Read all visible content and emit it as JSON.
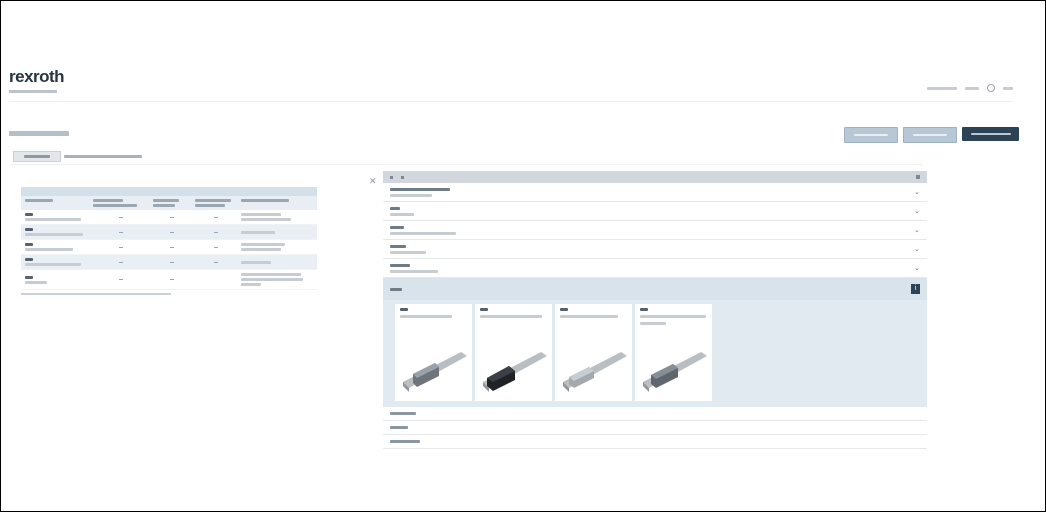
{
  "header": {
    "brand_name": "rexroth",
    "brand_color": "#2a3440"
  },
  "actions": {
    "primary_color": "#2c4356",
    "secondary_color": "#b8c7d6"
  },
  "product_cards": [
    {
      "icon": "rail-block-icon"
    },
    {
      "icon": "rail-block-icon"
    },
    {
      "icon": "rail-block-icon"
    },
    {
      "icon": "rail-block-icon"
    }
  ]
}
